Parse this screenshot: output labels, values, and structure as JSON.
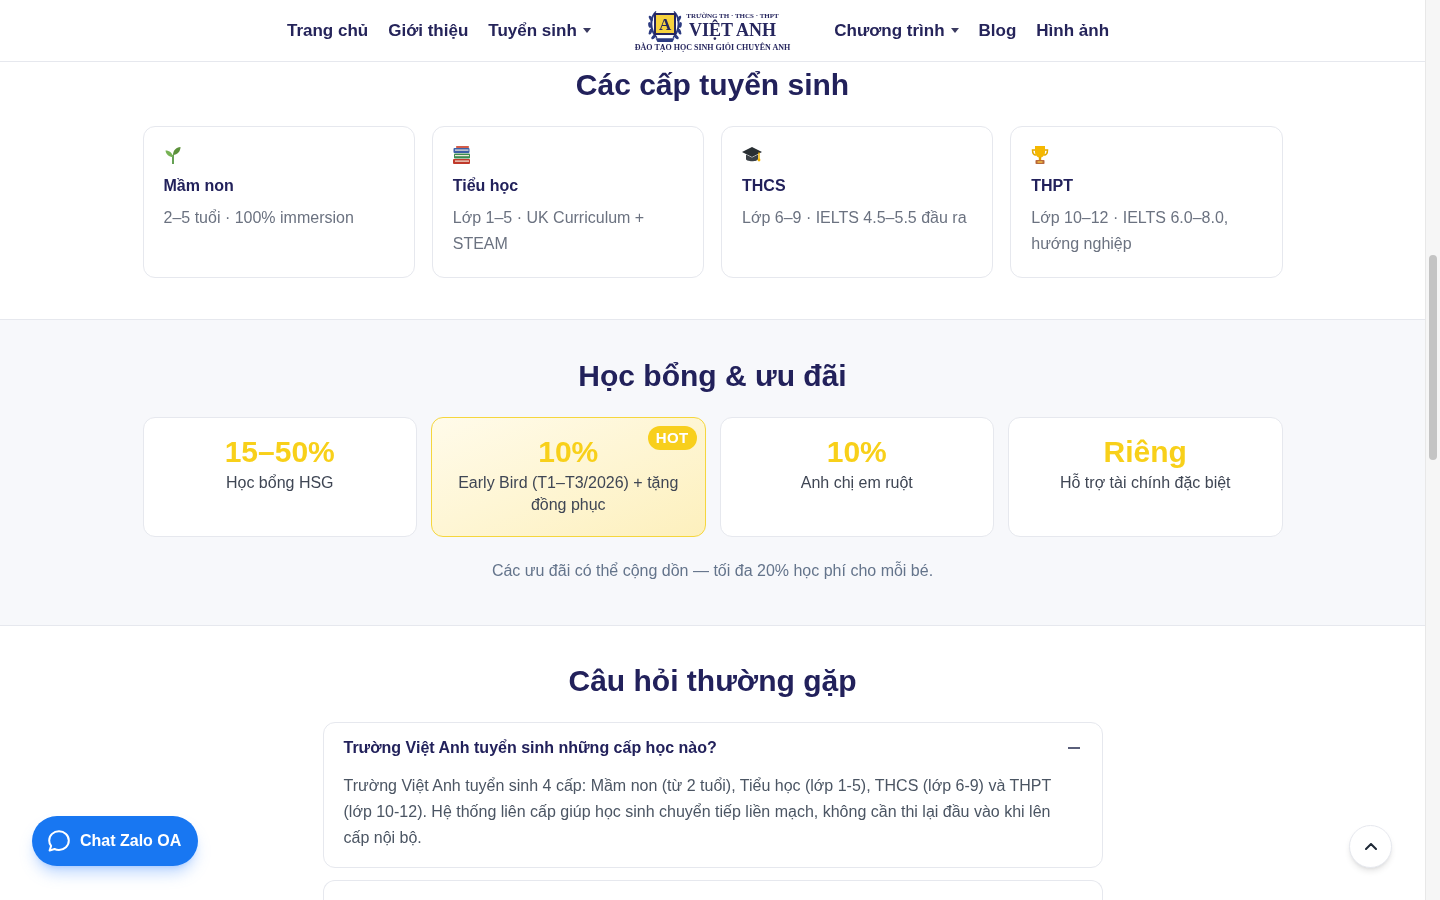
{
  "header": {
    "nav_left": [
      {
        "label": "Trang chủ",
        "has_dropdown": false
      },
      {
        "label": "Giới thiệu",
        "has_dropdown": false
      },
      {
        "label": "Tuyển sinh",
        "has_dropdown": true
      }
    ],
    "logo": {
      "emblem_letter": "A",
      "top_line": "TRƯỜNG TH · THCS · THPT",
      "name": "VIỆT ANH",
      "tagline": "ĐÀO TẠO HỌC SINH GIỎI CHUYÊN ANH"
    },
    "nav_right": [
      {
        "label": "Chương trình",
        "has_dropdown": true
      },
      {
        "label": "Blog",
        "has_dropdown": false
      },
      {
        "label": "Hình ảnh",
        "has_dropdown": false
      }
    ]
  },
  "levels": {
    "title": "Các cấp tuyển sinh",
    "cards": [
      {
        "title": "Mầm non",
        "description": "2–5 tuổi · 100% immersion"
      },
      {
        "title": "Tiểu học",
        "description": "Lớp 1–5 · UK Curriculum + STEAM"
      },
      {
        "title": "THCS",
        "description": "Lớp 6–9 · IELTS 4.5–5.5 đầu ra"
      },
      {
        "title": "THPT",
        "description": "Lớp 10–12 · IELTS 6.0–8.0, hướng nghiệp"
      }
    ]
  },
  "scholarships": {
    "title": "Học bổng & ưu đãi",
    "cards": [
      {
        "value": "15–50%",
        "label": "Học bổng HSG",
        "highlighted": false
      },
      {
        "value": "10%",
        "label": "Early Bird (T1–T3/2026) + tặng đồng phục",
        "highlighted": true,
        "badge": "HOT"
      },
      {
        "value": "10%",
        "label": "Anh chị em ruột",
        "highlighted": false
      },
      {
        "value": "Riêng",
        "label": "Hỗ trợ tài chính đặc biệt",
        "highlighted": false
      }
    ],
    "note": "Các ưu đãi có thể cộng dồn — tối đa 20% học phí cho mỗi bé."
  },
  "faq": {
    "title": "Câu hỏi thường gặp",
    "items": [
      {
        "question": "Trường Việt Anh tuyển sinh những cấp học nào?",
        "answer": "Trường Việt Anh tuyển sinh 4 cấp: Mầm non (từ 2 tuổi), Tiểu học (lớp 1-5), THCS (lớp 6-9) và THPT (lớp 10-12). Hệ thống liên cấp giúp học sinh chuyển tiếp liền mạch, không cần thi lại đầu vào khi lên cấp nội bộ.",
        "expanded": true
      }
    ]
  },
  "chat_button": {
    "label": "Chat Zalo OA"
  }
}
